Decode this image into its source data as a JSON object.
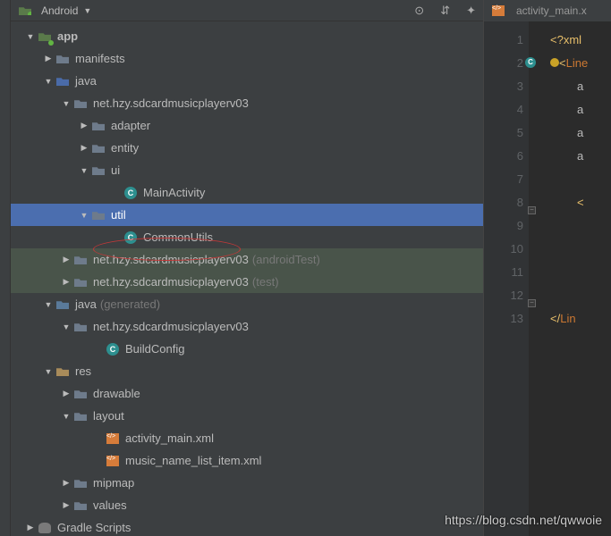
{
  "toolbar": {
    "label": "Android"
  },
  "tree": {
    "app": "app",
    "manifests": "manifests",
    "java": "java",
    "pkg": "net.hzy.sdcardmusicplayerv03",
    "adapter": "adapter",
    "entity": "entity",
    "ui": "ui",
    "mainActivity": "MainActivity",
    "util": "util",
    "commonUtils": "CommonUtils",
    "androidTest": "(androidTest)",
    "test": "(test)",
    "javaGen": "java",
    "generated": "(generated)",
    "buildConfig": "BuildConfig",
    "res": "res",
    "drawable": "drawable",
    "layout": "layout",
    "activityMain": "activity_main.xml",
    "musicList": "music_name_list_item.xml",
    "mipmap": "mipmap",
    "values": "values",
    "gradle": "Gradle Scripts"
  },
  "editorTab": "activity_main.x",
  "code": {
    "l1": "<?xml",
    "l2_open": "<",
    "l2_tag": "Line",
    "l3": "a",
    "l4": "a",
    "l5": "a",
    "l6": "a",
    "l8": "<",
    "l13_open": "</",
    "l13_tag": "Lin"
  },
  "lines": [
    "1",
    "2",
    "3",
    "4",
    "5",
    "6",
    "7",
    "8",
    "9",
    "10",
    "11",
    "12",
    "13"
  ],
  "watermark": "https://blog.csdn.net/qwwoie"
}
